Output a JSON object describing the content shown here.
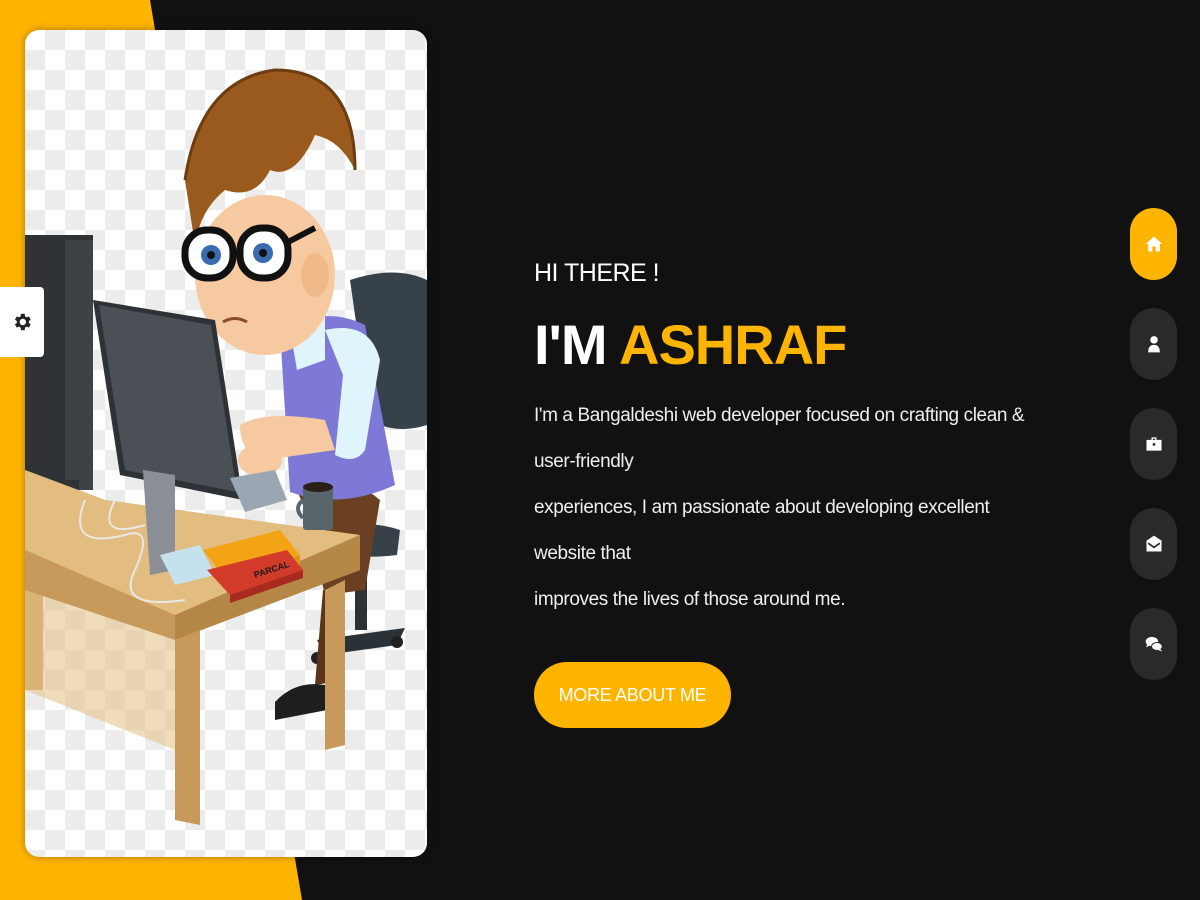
{
  "hero": {
    "greeting": "HI THERE !",
    "headline_prefix": "I'M",
    "headline_name": "ASHRAF",
    "bio_lines": [
      "I'm a Bangaldeshi web developer focused on crafting clean & user-friendly",
      "experiences, I am passionate about developing excellent website that",
      "improves the lives of those around me."
    ],
    "cta_label": "MORE ABOUT ME"
  },
  "illustration": {
    "book_label": "PARCAL"
  },
  "settings": {
    "icon": "gear-icon"
  },
  "nav": {
    "active": "home",
    "items": [
      {
        "id": "home",
        "icon": "home-icon"
      },
      {
        "id": "about",
        "icon": "user-icon"
      },
      {
        "id": "portfolio",
        "icon": "briefcase-icon"
      },
      {
        "id": "contact",
        "icon": "envelope-open-icon"
      },
      {
        "id": "blog",
        "icon": "comments-icon"
      }
    ]
  },
  "colors": {
    "accent": "#ffb400",
    "background": "#111111",
    "nav_inactive": "#2b2a2a",
    "text": "#ffffff"
  }
}
